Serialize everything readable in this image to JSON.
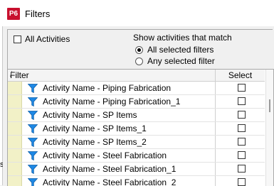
{
  "window": {
    "title": "Filters",
    "logo": "P6"
  },
  "background": {
    "glyph": "s"
  },
  "options": {
    "all_activities_label": "All Activities",
    "all_activities_checked": false,
    "match_label": "Show activities that match",
    "radio_all_label": "All selected filters",
    "radio_any_label": "Any selected filter",
    "selected_mode": "all"
  },
  "grid": {
    "columns": {
      "filter": "Filter",
      "select": "Select",
      "sort_glyph": "/"
    },
    "rows": [
      {
        "name": "Activity Name - Piping Fabrication",
        "selected": false
      },
      {
        "name": "Activity Name - Piping Fabrication_1",
        "selected": false
      },
      {
        "name": "Activity Name - SP Items",
        "selected": false
      },
      {
        "name": "Activity Name - SP Items_1",
        "selected": false
      },
      {
        "name": "Activity Name - SP Items_2",
        "selected": false
      },
      {
        "name": "Activity Name - Steel Fabrication",
        "selected": false
      },
      {
        "name": "Activity Name - Steel Fabrication_1",
        "selected": false
      },
      {
        "name": "Activity Name - Steel Fabrication_2",
        "selected": false
      }
    ]
  },
  "colors": {
    "logo": "#c8102e",
    "filter_icon": "#1e88e5",
    "row_gutter": "#f2f1c7"
  },
  "icons": {
    "row_icon": "funnel-icon",
    "logo_icon": "p6-logo-icon"
  }
}
